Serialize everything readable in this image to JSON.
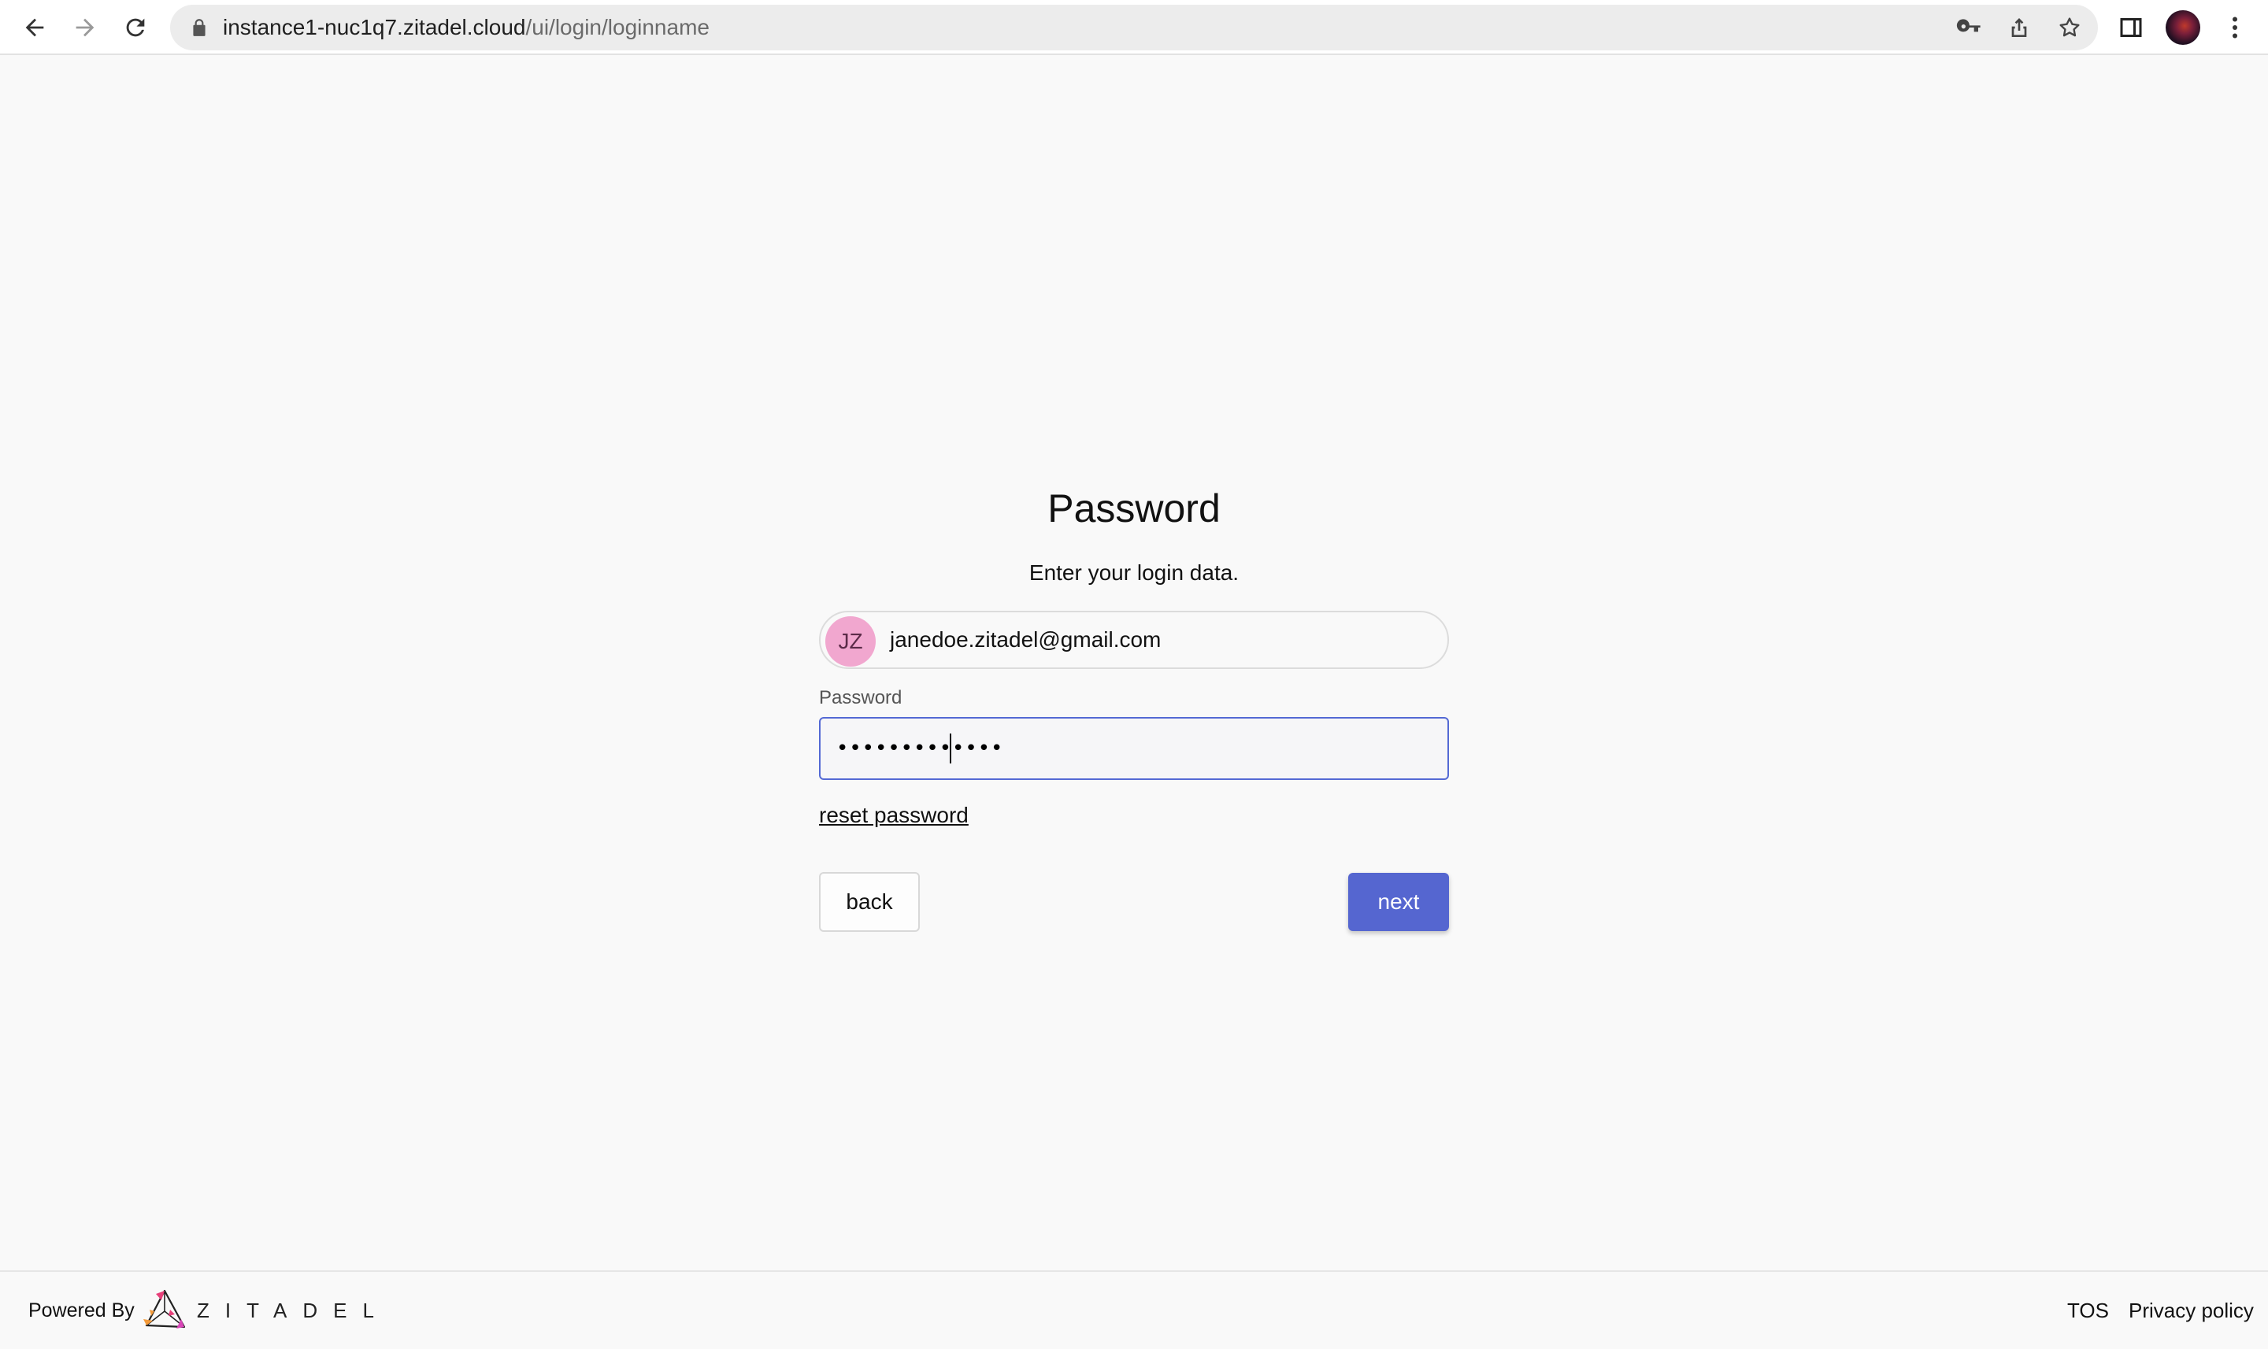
{
  "browser": {
    "url_host": "instance1-nuc1q7.zitadel.cloud",
    "url_path": "/ui/login/loginname",
    "icons": {
      "back": "arrow-left-icon",
      "forward": "arrow-right-icon",
      "reload": "reload-icon",
      "lock": "lock-icon",
      "key": "key-icon",
      "share": "share-icon",
      "bookmark": "star-icon",
      "side_panel": "side-panel-icon",
      "profile": "profile-avatar",
      "menu": "kebab-menu-icon"
    }
  },
  "login": {
    "title": "Password",
    "subtitle": "Enter your login data.",
    "user": {
      "initials": "JZ",
      "email": "janedoe.zitadel@gmail.com",
      "avatar_color": "#f1a7cf"
    },
    "password_label": "Password",
    "password_value": "•••••••••••••",
    "reset_link": "reset password",
    "back_label": "back",
    "next_label": "next",
    "accent_color": "#5566d0"
  },
  "footer": {
    "powered_by": "Powered By",
    "brand": "ZITADEL",
    "tos": "TOS",
    "privacy": "Privacy policy"
  }
}
